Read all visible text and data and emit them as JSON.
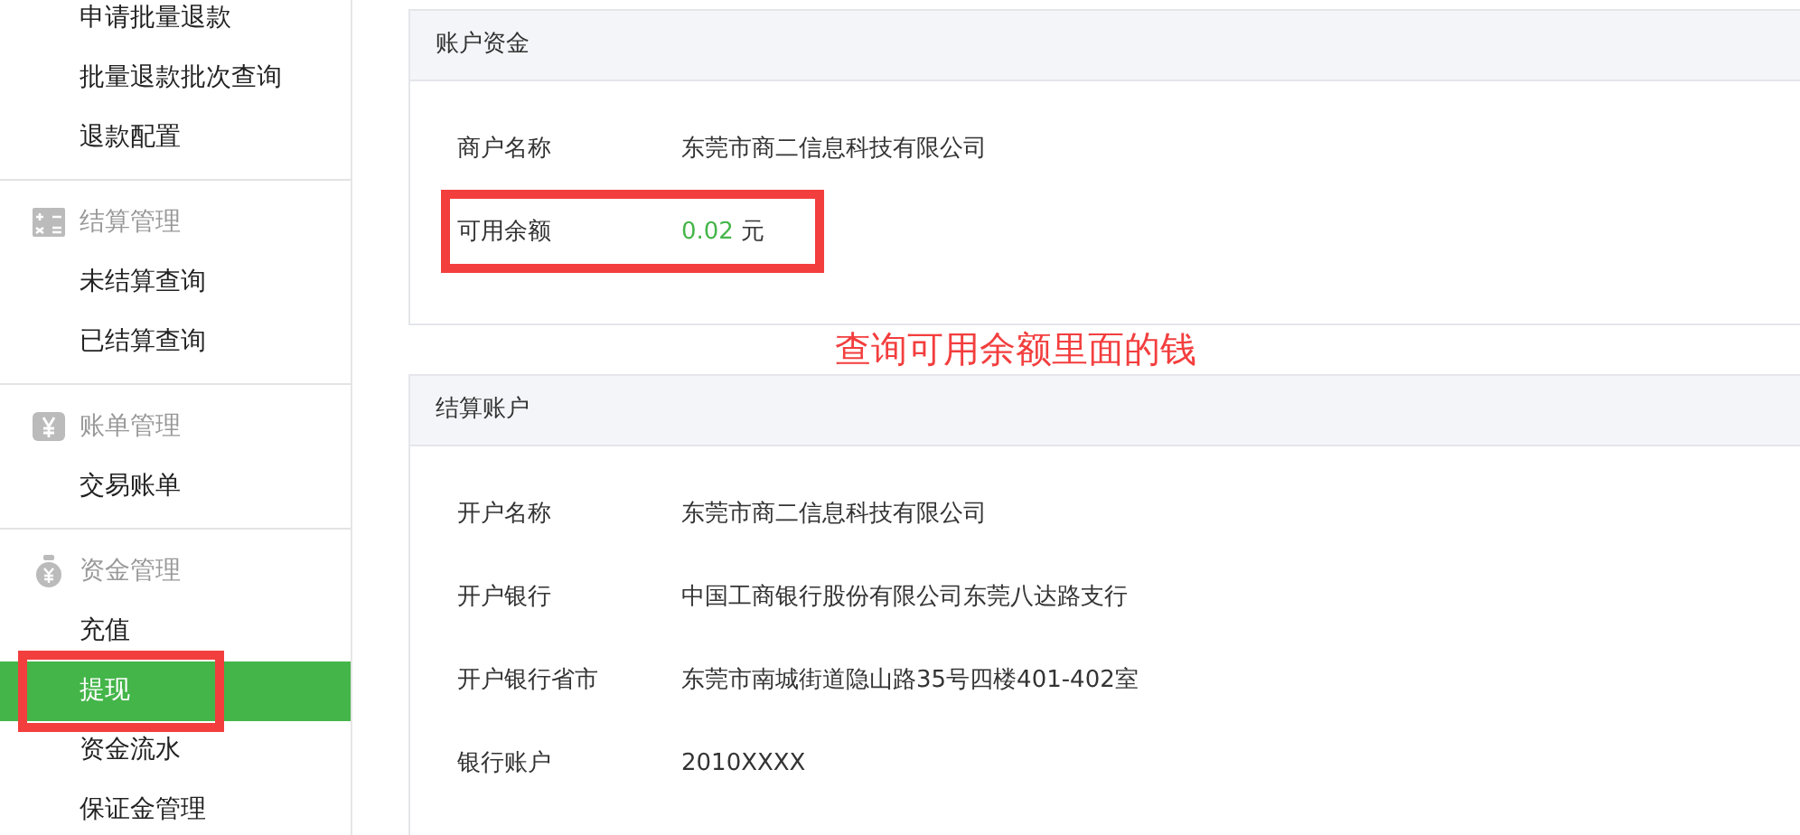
{
  "sidebar": {
    "groups": [
      {
        "items": [
          {
            "label": "申请批量退款",
            "selected": false,
            "annotated": false
          },
          {
            "label": "批量退款批次查询",
            "selected": false,
            "annotated": false
          },
          {
            "label": "退款配置",
            "selected": false,
            "annotated": false
          }
        ]
      },
      {
        "header": "结算管理",
        "items": [
          {
            "label": "未结算查询",
            "selected": false,
            "annotated": false
          },
          {
            "label": "已结算查询",
            "selected": false,
            "annotated": false
          }
        ]
      },
      {
        "header": "账单管理",
        "items": [
          {
            "label": "交易账单",
            "selected": false,
            "annotated": false
          }
        ]
      },
      {
        "header": "资金管理",
        "items": [
          {
            "label": "充值",
            "selected": false,
            "annotated": false
          },
          {
            "label": "提现",
            "selected": true,
            "annotated": true
          },
          {
            "label": "资金流水",
            "selected": false,
            "annotated": false
          },
          {
            "label": "保证金管理",
            "selected": false,
            "annotated": false
          }
        ]
      }
    ]
  },
  "panels": [
    {
      "title": "账户资金",
      "fields": [
        {
          "kind": "text",
          "label": "商户名称",
          "value": "东莞市商二信息科技有限公司",
          "annotated": false
        },
        {
          "kind": "amount",
          "label": "可用余额",
          "amount": "0.02",
          "unit": "元",
          "annotated": true
        }
      ]
    },
    {
      "title": "结算账户",
      "fields": [
        {
          "kind": "text",
          "label": "开户名称",
          "value": "东莞市商二信息科技有限公司",
          "annotated": false
        },
        {
          "kind": "text",
          "label": "开户银行",
          "value": "中国工商银行股份有限公司东莞八达路支行",
          "annotated": false
        },
        {
          "kind": "text",
          "label": "开户银行省市",
          "value": "东莞市南城街道隐山路35号四楼401-402室",
          "annotated": false
        },
        {
          "kind": "text",
          "label": "银行账户",
          "value": "2010XXXX",
          "annotated": false
        }
      ]
    }
  ],
  "annotation_note": "查询可用余额里面的钱"
}
